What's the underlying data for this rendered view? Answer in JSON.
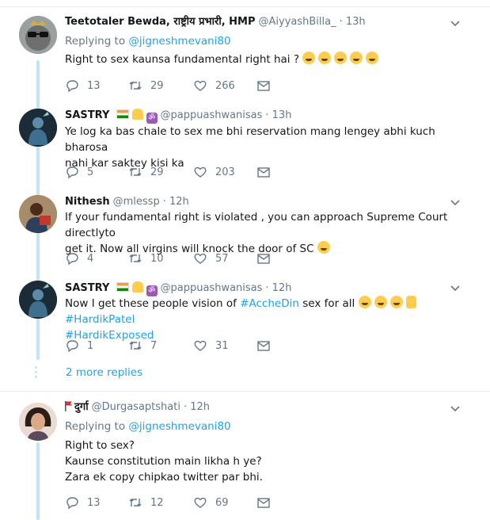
{
  "tweets": [
    {
      "name": "Teetotaler Bewda, राष्ट्रीय प्रभारी, HMP",
      "handle": "@AiyyashBilla_",
      "time": "· 13h",
      "replying_prefix": "Replying to ",
      "replying_to": "@jigneshmevani80",
      "text": "Right to sex kaunsa fundamental right hai ?",
      "replies": "13",
      "retweets": "29",
      "likes": "266"
    },
    {
      "name": "SASTRY",
      "handle": "@pappuashwanisas",
      "time": "· 13h",
      "text_line1": "Ye log ka bas chale to sex me bhi reservation mang lengey abhi kuch bharosa",
      "text_line2": "nahi kar saktey kisi ka",
      "replies": "5",
      "retweets": "29",
      "likes": "203"
    },
    {
      "name": "Nithesh",
      "handle": "@mlessp",
      "time": "· 12h",
      "text_line1": "If your fundamental right is violated , you can approach Supreme Court directlyto",
      "text_line2": "get it. Now all virgins will knock the door of SC",
      "replies": "4",
      "retweets": "10",
      "likes": "57"
    },
    {
      "name": "SASTRY",
      "handle": "@pappuashwanisas",
      "time": "· 12h",
      "text_prefix": "Now I get these people vision of ",
      "hashtag1": "#AccheDin",
      "text_mid": " sex for all ",
      "hashtag2": "#HardikPatel",
      "hashtag3": "#HardikExposed",
      "replies": "1",
      "retweets": "7",
      "likes": "31"
    },
    {
      "name": "दुर्गा",
      "handle": "@Durgasaptshati",
      "time": "· 12h",
      "replying_prefix": "Replying to ",
      "replying_to": "@jigneshmevani80",
      "text_line1": "Right to sex?",
      "text_line2": "Kaunse constitution main likha h ye?",
      "text_line3": "Zara ek copy chipkao twitter par bhi.",
      "replies": "13",
      "retweets": "12",
      "likes": "69"
    }
  ],
  "more_replies": "2 more replies",
  "icons": {
    "reply": "reply-icon",
    "retweet": "retweet-icon",
    "like": "heart-icon",
    "dm": "envelope-icon",
    "caret": "chevron-down-icon"
  },
  "colors": {
    "link": "#1da1f2",
    "muted": "#657786",
    "thread_line": "#c4e3f2",
    "border": "#e6ecf0"
  }
}
